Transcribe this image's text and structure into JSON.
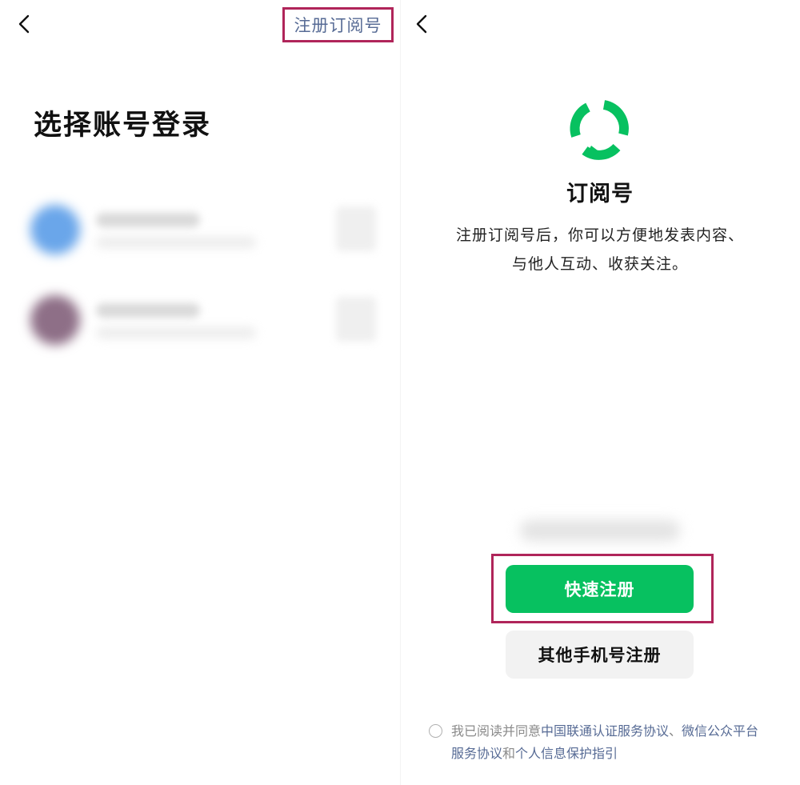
{
  "left_screen": {
    "top_right_link": "注册订阅号",
    "title": "选择账号登录"
  },
  "right_screen": {
    "title": "订阅号",
    "description_line1": "注册订阅号后，你可以方便地发表内容、",
    "description_line2": "与他人互动、收获关注。",
    "primary_button": "快速注册",
    "secondary_button": "其他手机号注册",
    "agreement": {
      "prefix": "我已阅读并同意",
      "link1": "中国联通认证服务协议",
      "sep1": "、",
      "link2": "微信公众平台服务协议",
      "sep2": "和",
      "link3": "个人信息保护指引"
    }
  },
  "colors": {
    "accent_green": "#07c160",
    "link_blue": "#576b95",
    "highlight_box": "#b0255a"
  },
  "icons": {
    "back": "chevron-left-icon",
    "logo": "subscription-account-logo-icon"
  }
}
